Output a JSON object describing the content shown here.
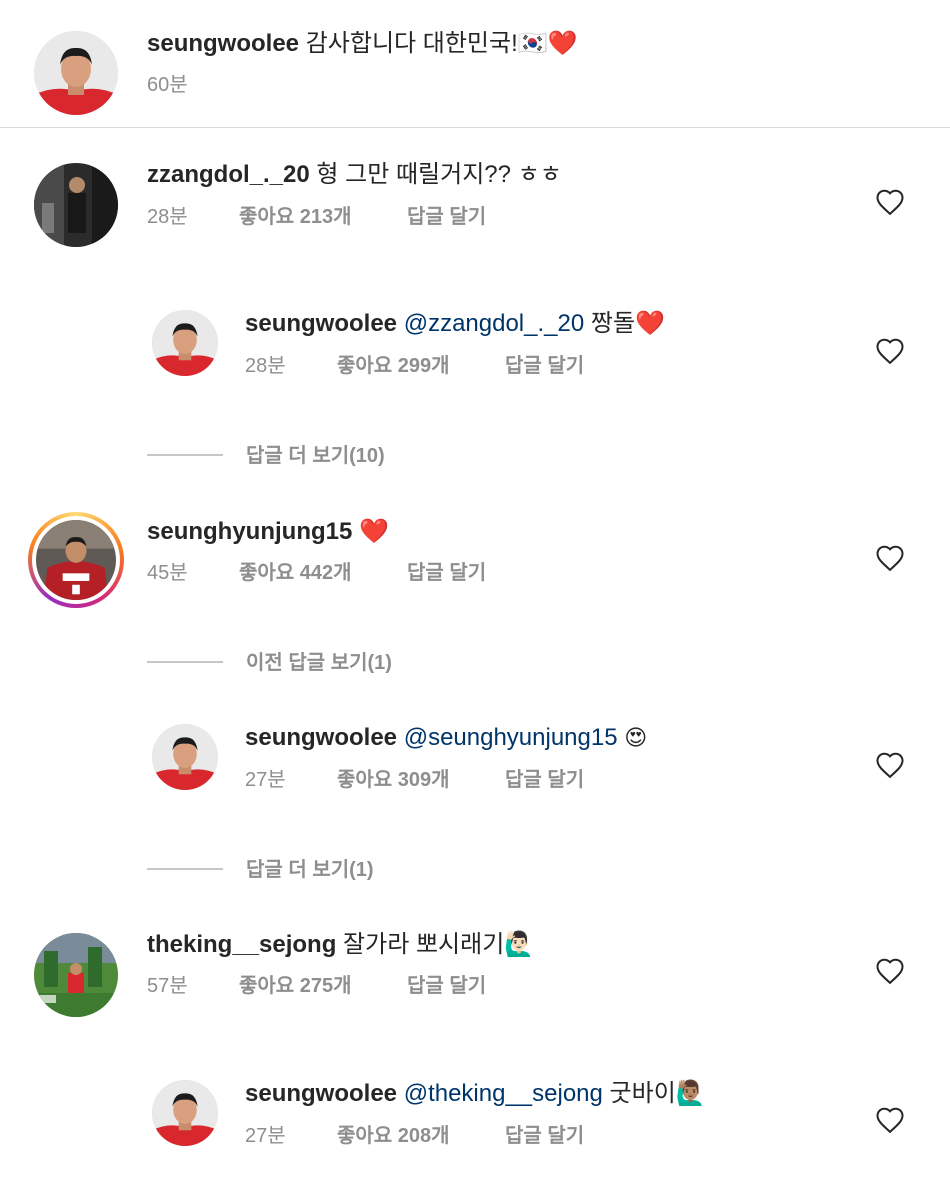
{
  "caption": {
    "username": "seungwoolee",
    "text": "감사합니다 대한민국!🇰🇷❤️",
    "time": "60분"
  },
  "comments": [
    {
      "username": "zzangdol_._20",
      "text": "형 그만 때릴거지?? ㅎㅎ",
      "time": "28분",
      "likes": "좋아요 213개",
      "reply": "답글 달기"
    },
    {
      "username": "seungwoolee",
      "mention": "@zzangdol_._20",
      "text": "짱돌❤️",
      "time": "28분",
      "likes": "좋아요 299개",
      "reply": "답글 달기"
    },
    {
      "username": "seunghyunjung15",
      "text": "❤️",
      "time": "45분",
      "likes": "좋아요 442개",
      "reply": "답글 달기"
    },
    {
      "username": "seungwoolee",
      "mention": "@seunghyunjung15",
      "text": "😍",
      "time": "27분",
      "likes": "좋아요 309개",
      "reply": "답글 달기"
    },
    {
      "username": "theking__sejong",
      "text": "잘가라 뽀시래기🙋🏻‍♂️",
      "time": "57분",
      "likes": "좋아요 275개",
      "reply": "답글 달기"
    },
    {
      "username": "seungwoolee",
      "mention": "@theking__sejong",
      "text": "굿바이🙋🏽‍♂️",
      "time": "27분",
      "likes": "좋아요 208개",
      "reply": "답글 달기"
    }
  ],
  "view_more": [
    "답글 더 보기(10)",
    "이전 답글 보기(1)",
    "답글 더 보기(1)"
  ],
  "icons": {
    "like": "heart-outline-icon"
  },
  "colors": {
    "mention": "#003569",
    "meta": "#8e8e8e",
    "heart": "#ed2b3d"
  }
}
